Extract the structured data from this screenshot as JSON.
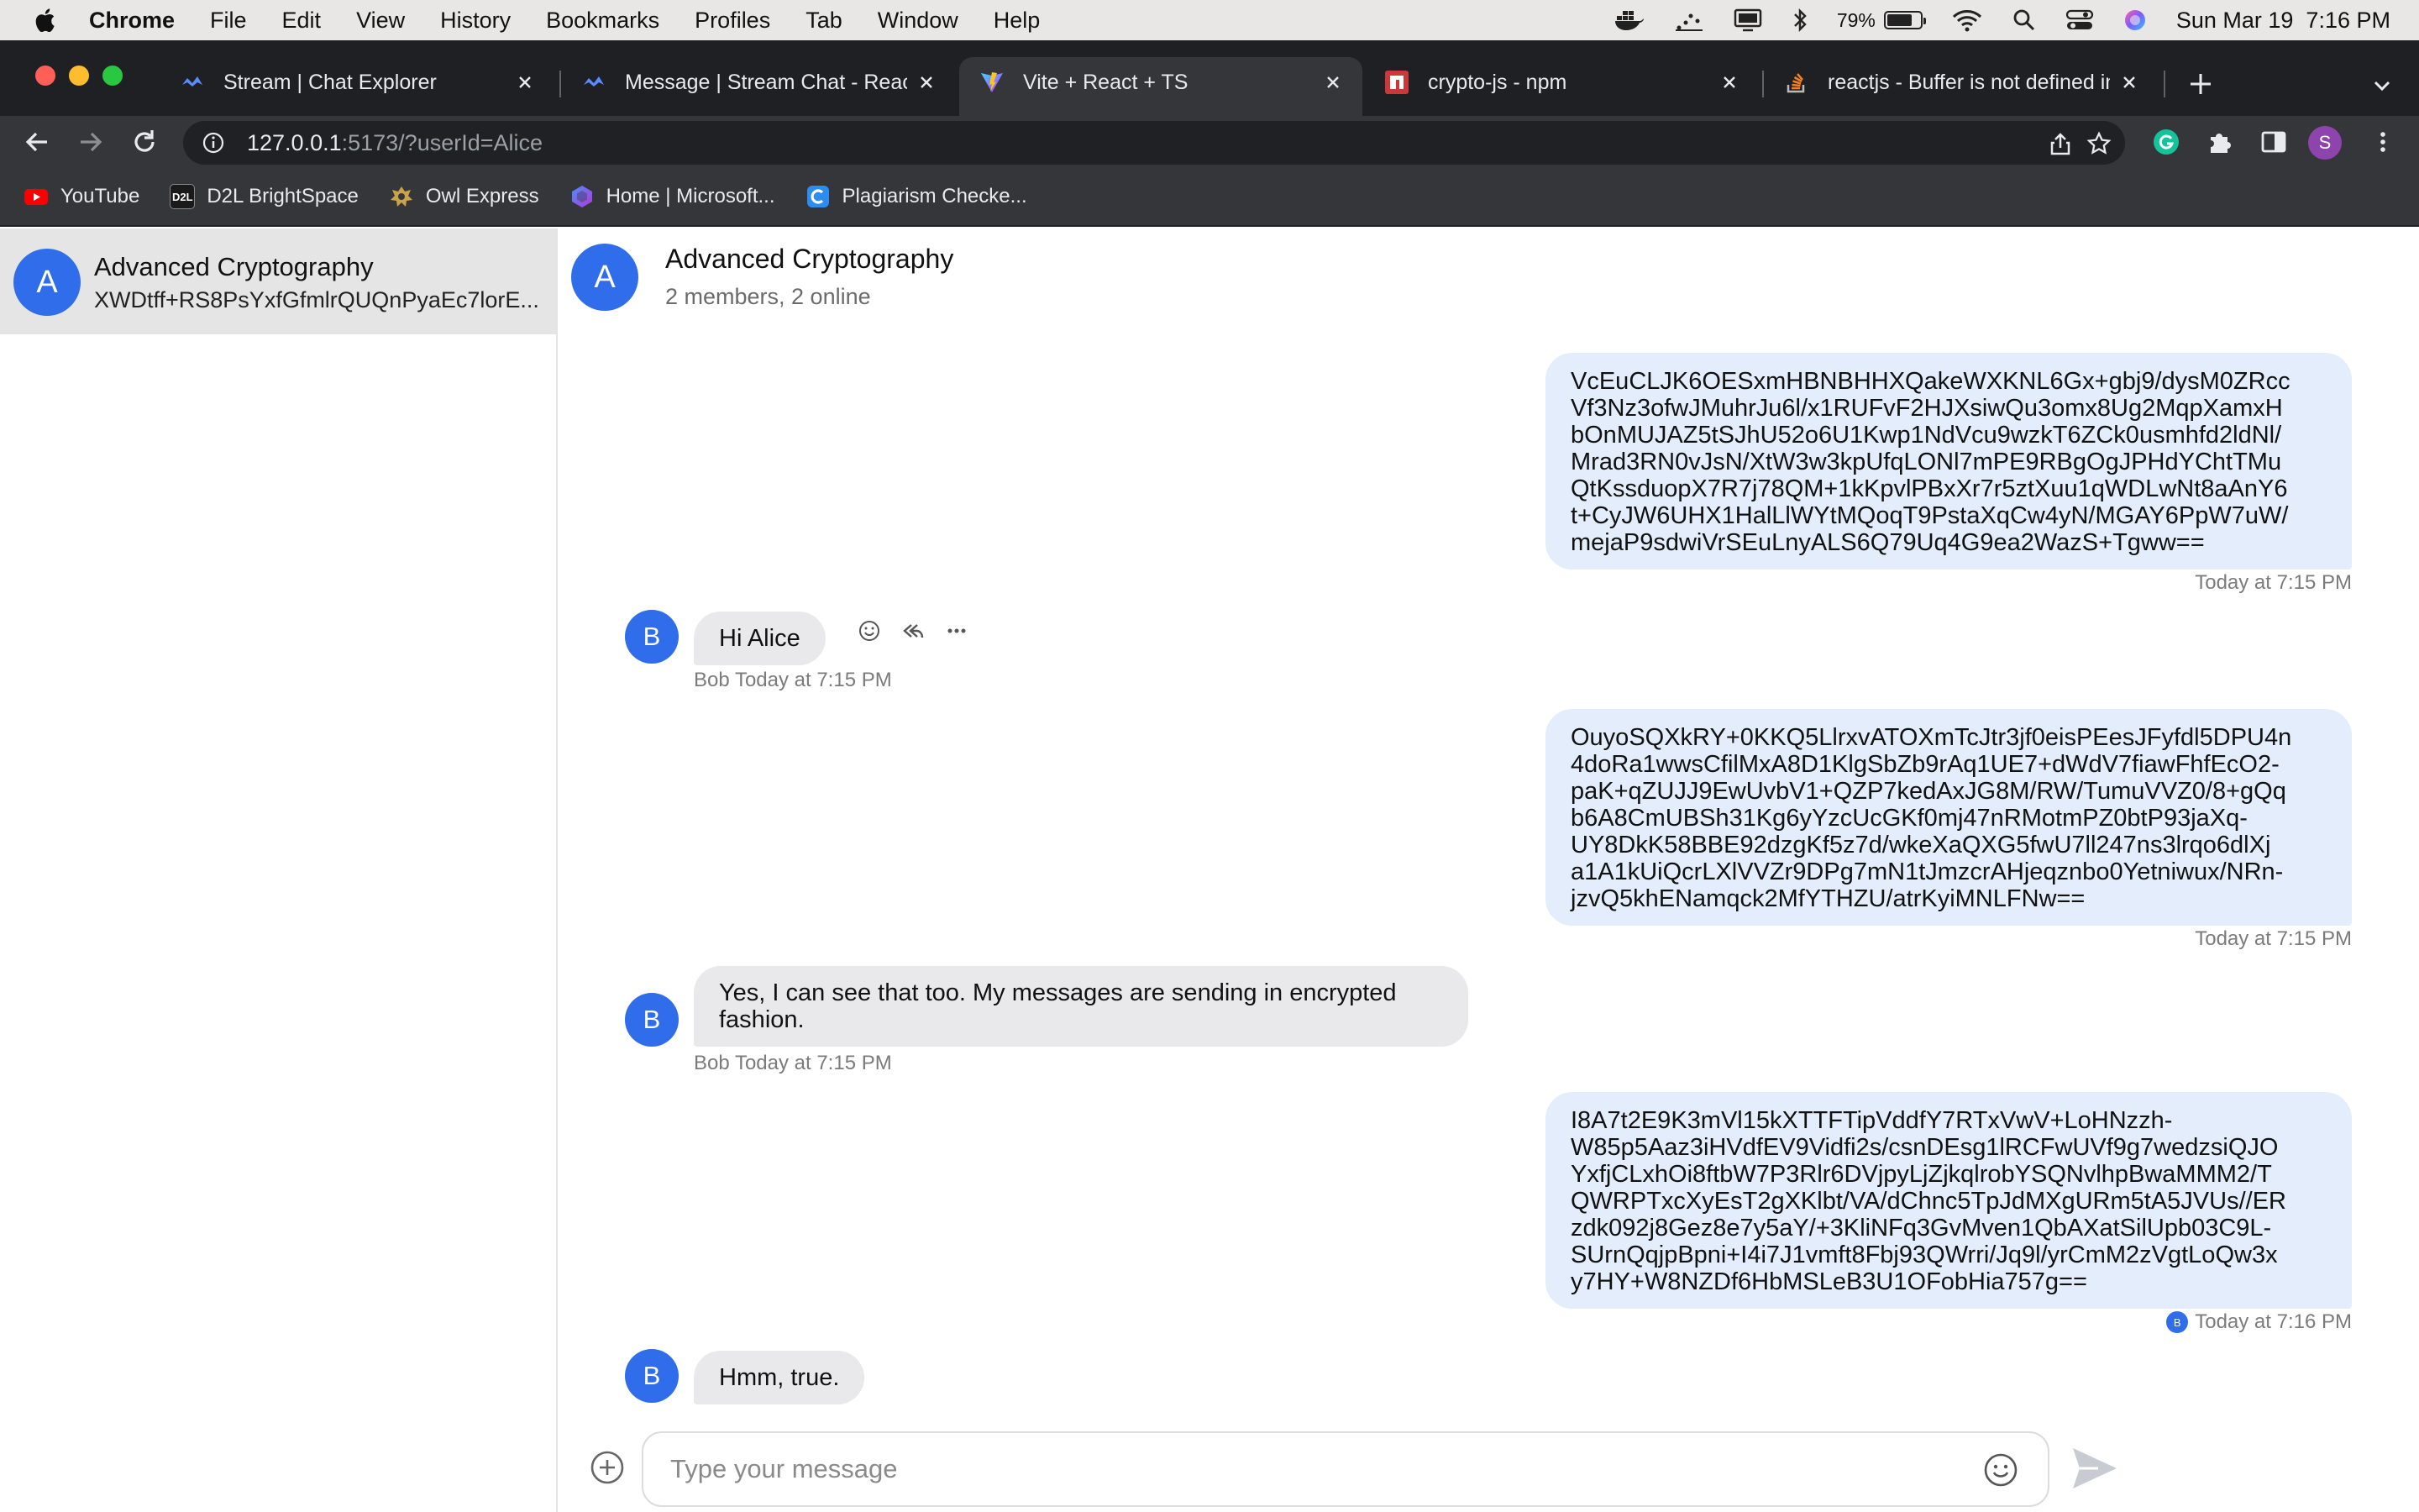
{
  "menubar": {
    "app_name": "Chrome",
    "items": [
      "File",
      "Edit",
      "View",
      "History",
      "Bookmarks",
      "Profiles",
      "Tab",
      "Window",
      "Help"
    ],
    "battery_percent": "79%",
    "battery_level": 0.79,
    "datetime": "Sun Mar 19  7:16 PM"
  },
  "tabs": [
    {
      "title": "Stream | Chat Explorer",
      "icon": "stream-logo-icon"
    },
    {
      "title": "Message | Stream Chat - React",
      "icon": "stream-logo-icon"
    },
    {
      "title": "Vite + React + TS",
      "icon": "vite-logo-icon",
      "active": true
    },
    {
      "title": "crypto-js - npm",
      "icon": "npm-logo-icon"
    },
    {
      "title": "reactjs - Buffer is not defined in",
      "icon": "stackoverflow-logo-icon"
    }
  ],
  "address_bar": {
    "host": "127.0.0.1",
    "rest": ":5173/?userId=Alice"
  },
  "profile_initial": "S",
  "bookmarks": [
    {
      "label": "YouTube",
      "icon": "youtube-icon",
      "color": "#ff0000"
    },
    {
      "label": "D2L BrightSpace",
      "icon": "d2l-icon",
      "color": "#1a1a1a",
      "icon_text": "D2L"
    },
    {
      "label": "Owl Express",
      "icon": "owl-icon",
      "color": "#b8962e"
    },
    {
      "label": "Home | Microsoft...",
      "icon": "microsoft-icon",
      "color": "#6b5bd6"
    },
    {
      "label": "Plagiarism Checke...",
      "icon": "plagiarism-icon",
      "color": "#2d8cf0"
    }
  ],
  "sidebar": {
    "channel": {
      "avatar_initial": "A",
      "name": "Advanced Cryptography",
      "last_message": "XWDtff+RS8PsYxfGfmlrQUQnPyaEc7lorE..."
    }
  },
  "chat": {
    "header": {
      "avatar_initial": "A",
      "title": "Advanced Cryptography",
      "subtitle": "2 members, 2 online"
    },
    "messages": [
      {
        "mine": true,
        "lines": [
          "VcEuCLJK6OESxmHBNBHHXQakeWXKNL6Gx+gbj9/dysM0ZRcc",
          "Vf3Nz3ofwJMuhrJu6l/x1RUFvF2HJXsiwQu3omx8Ug2MqpXamxH",
          "bOnMUJAZ5tSJhU52o6U1Kwp1NdVcu9wzkT6ZCk0usmhfd2ldNl/",
          "Mrad3RN0vJsN/XtW3w3kpUfqLONl7mPE9RBgOgJPHdYChtTMu",
          "QtKssduopX7R7j78QM+1kKpvlPBxXr7r5ztXuu1qWDLwNt8aAnY6",
          "t+CyJW6UHX1HalLlWYtMQoqT9PstaXqCw4yN/MGAY6PpW7uW/",
          "mejaP9sdwiVrSEuLnyALS6Q79Uq4G9ea2WazS+Tgww=="
        ],
        "time": "Today at 7:15 PM"
      },
      {
        "mine": false,
        "avatar_initial": "B",
        "text": "Hi Alice",
        "author": "Bob",
        "time": "Today at 7:15 PM"
      },
      {
        "mine": true,
        "lines": [
          "OuyoSQXkRY+0KKQ5LlrxvATOXmTcJtr3jf0eisPEesJFyfdl5DPU4n",
          "4doRa1wwsCfilMxA8D1KlgSbZb9rAq1UE7+dWdV7fiawFhfEcO2-",
          "paK+qZUJJ9EwUvbV1+QZP7kedAxJG8M/RW/TumuVVZ0/8+gQq",
          "b6A8CmUBSh31Kg6yYzcUcGKf0mj47nRMotmPZ0btP93jaXq-",
          "UY8DkK58BBE92dzgKf5z7d/wkeXaQXG5fwU7ll247ns3lrqo6dlXj",
          "a1A1kUiQcrLXlVVZr9DPg7mN1tJmzcrAHjeqznbo0Yetniwux/NRn-",
          "jzvQ5khENamqck2MfYTHZU/atrKyiMNLFNw=="
        ],
        "time": "Today at 7:15 PM"
      },
      {
        "mine": false,
        "avatar_initial": "B",
        "lines": [
          "Yes, I can see that too. My messages are sending in encrypted",
          "fashion."
        ],
        "author": "Bob",
        "time": "Today at 7:15 PM"
      },
      {
        "mine": true,
        "lines": [
          "I8A7t2E9K3mVl15kXTTFTipVddfY7RTxVwV+LoHNzzh-",
          "W85p5Aaz3iHVdfEV9Vidfi2s/csnDEsg1lRCFwUVf9g7wedzsiQJO",
          "YxfjCLxhOi8ftbW7P3Rlr6DVjpyLjZjkqlrobYSQNvlhpBwaMMM2/T",
          "QWRPTxcXyEsT2gXKlbt/VA/dChnc5TpJdMXgURm5tA5JVUs//ER",
          "zdk092j8Gez8e7y5aY/+3KliNFq3GvMven1QbAXatSilUpb03C9L-",
          "SUrnQqjpBpni+I4i7J1vmft8Fbj93QWrri/Jq9l/yrCmM2zVgtLoQw3x",
          "y7HY+W8NZDf6HbMSLeB3U1OFobHia757g=="
        ],
        "time": "Today at 7:16 PM",
        "read_avatar": "B"
      },
      {
        "mine": false,
        "avatar_initial": "B",
        "text": "Hmm, true."
      }
    ],
    "composer": {
      "placeholder": "Type your message"
    }
  },
  "colors": {
    "accent": "#2f6dea",
    "my_bubble": "#e3edfc",
    "other_bubble": "#e9e9eb",
    "chrome_dark": "#35363a",
    "tabstrip": "#1f2023"
  }
}
